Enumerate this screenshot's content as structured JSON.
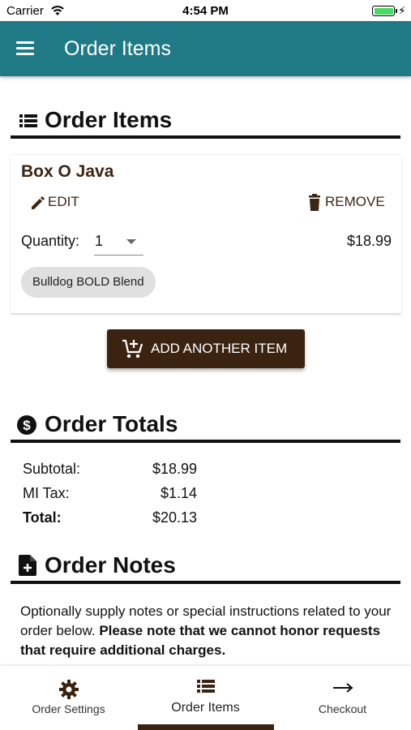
{
  "status_bar": {
    "carrier": "Carrier",
    "time": "4:54 PM",
    "battery_color": "#4cd964"
  },
  "app_bar": {
    "title": "Order Items",
    "menu_icon": "hamburger-menu-icon",
    "color": "#1f7a86"
  },
  "items_section": {
    "title": "Order Items",
    "icon": "list-icon",
    "items": [
      {
        "name": "Box O Java",
        "edit_label": "EDIT",
        "remove_label": "REMOVE",
        "quantity_label": "Quantity:",
        "quantity_value": "1",
        "price": "$18.99",
        "option_chip": "Bulldog BOLD Blend"
      }
    ],
    "add_button_label": "ADD ANOTHER ITEM",
    "add_button_color": "#3b2311"
  },
  "totals_section": {
    "title": "Order Totals",
    "icon": "dollar-circle-icon",
    "rows": [
      {
        "label": "Subtotal:",
        "value": "$18.99"
      },
      {
        "label": "MI Tax:",
        "value": "$1.14"
      },
      {
        "label": "Total:",
        "value": "$20.13"
      }
    ]
  },
  "notes_section": {
    "title": "Order Notes",
    "icon": "note-add-icon",
    "text_normal": "Optionally supply notes or special instructions related to your order below. ",
    "text_bold": "Please note that we cannot honor requests that require additional charges."
  },
  "bottom_nav": {
    "items": [
      {
        "label": "Order Settings",
        "icon": "gear-icon"
      },
      {
        "label": "Order Items",
        "icon": "list-icon"
      },
      {
        "label": "Checkout",
        "icon": "arrow-right-icon"
      }
    ],
    "active_index": 1,
    "accent_color": "#3b2311"
  }
}
